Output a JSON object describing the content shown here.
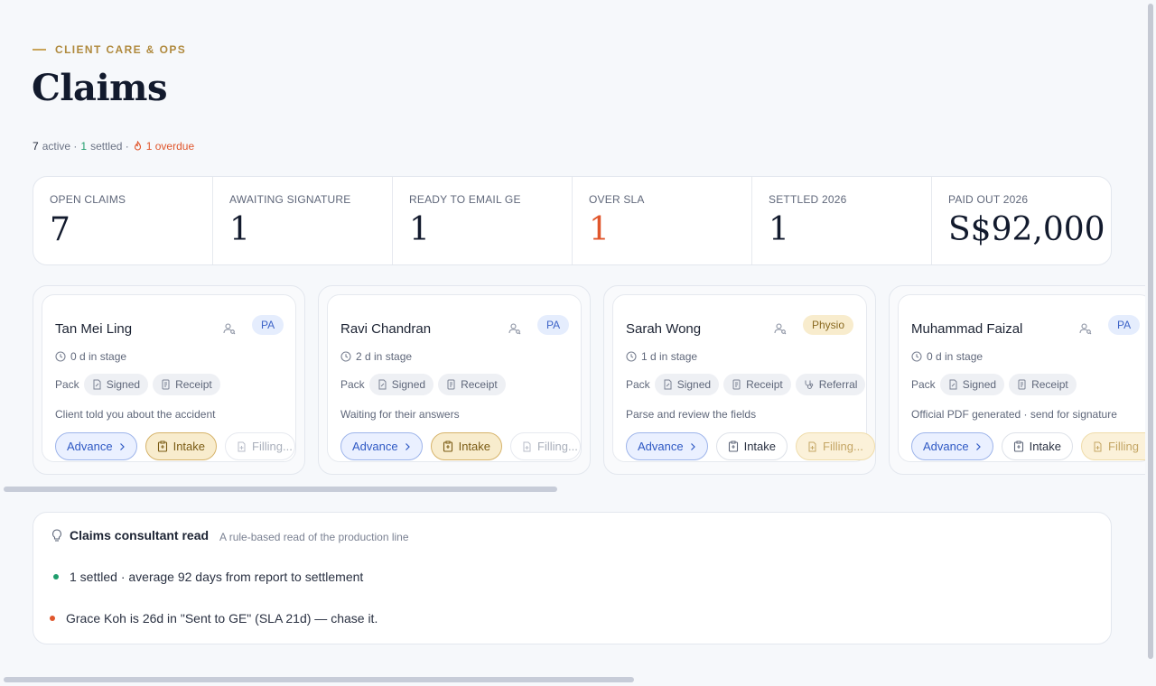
{
  "header": {
    "eyebrow": "CLIENT CARE & OPS",
    "title": "Claims"
  },
  "summary": {
    "active_count": "7",
    "active_label": "active ·",
    "settled_count": "1",
    "settled_label": "settled ·",
    "overdue_label": "1 overdue"
  },
  "stats": [
    {
      "label": "OPEN CLAIMS",
      "value": "7"
    },
    {
      "label": "AWAITING SIGNATURE",
      "value": "1"
    },
    {
      "label": "READY TO EMAIL GE",
      "value": "1"
    },
    {
      "label": "OVER SLA",
      "value": "1"
    },
    {
      "label": "SETTLED 2026",
      "value": "1"
    },
    {
      "label": "PAID OUT 2026",
      "value": "S$92,000"
    }
  ],
  "cards": [
    {
      "name": "Tan Mei Ling",
      "tag": "PA",
      "stage": "0 d in stage",
      "pack_label": "Pack",
      "chips": [
        "Signed",
        "Receipt"
      ],
      "note": "Client told you about the accident",
      "advance": "Advance",
      "intake": "Intake",
      "filling": "Filling..."
    },
    {
      "name": "Ravi Chandran",
      "tag": "PA",
      "stage": "2 d in stage",
      "pack_label": "Pack",
      "chips": [
        "Signed",
        "Receipt"
      ],
      "note": "Waiting for their answers",
      "advance": "Advance",
      "intake": "Intake",
      "filling": "Filling..."
    },
    {
      "name": "Sarah Wong",
      "tag": "Physio",
      "stage": "1 d in stage",
      "pack_label": "Pack",
      "chips": [
        "Signed",
        "Receipt",
        "Referral"
      ],
      "note": "Parse and review the fields",
      "advance": "Advance",
      "intake": "Intake",
      "filling": "Filling..."
    },
    {
      "name": "Muhammad Faizal",
      "tag": "PA",
      "stage": "0 d in stage",
      "pack_label": "Pack",
      "chips": [
        "Signed",
        "Receipt"
      ],
      "note": "Official PDF generated · send for signature",
      "advance": "Advance",
      "intake": "Intake",
      "filling": "Filling"
    }
  ],
  "consultant": {
    "title": "Claims consultant read",
    "subtitle": "A rule-based read of the production line",
    "items": [
      {
        "text": "1 settled · average 92 days from report to settlement",
        "status_color": "#1f9d6c"
      },
      {
        "text": "Grace Koh is 26d in \"Sent to GE\" (SLA 21d) — chase it.",
        "status_color": "#e0562c"
      }
    ]
  },
  "colors": {
    "accent_gold": "#b08a3e",
    "overdue_red": "#e0562c",
    "settled_green": "#1f9d6c",
    "advance_blue": "#2f59c4"
  }
}
